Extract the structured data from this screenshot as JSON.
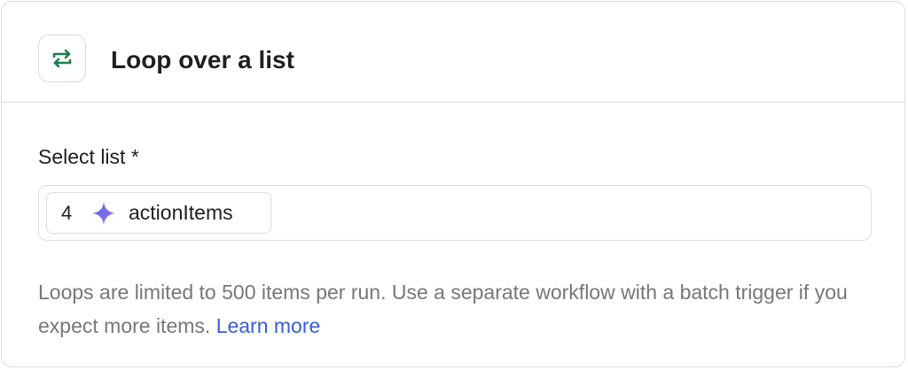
{
  "header": {
    "icon": "loop-arrows-icon",
    "title": "Loop over a list"
  },
  "form": {
    "label": "Select list *",
    "chip": {
      "step_number": "4",
      "icon": "sparkle-icon",
      "value": "actionItems"
    }
  },
  "help": {
    "text": "Loops are limited to 500 items per run. Use a separate workflow with a batch trigger if you expect more items.",
    "link": "Learn more"
  },
  "colors": {
    "icon_green": "#1f7a4d",
    "link_blue": "#3b5bdb",
    "help_gray": "#777777"
  }
}
